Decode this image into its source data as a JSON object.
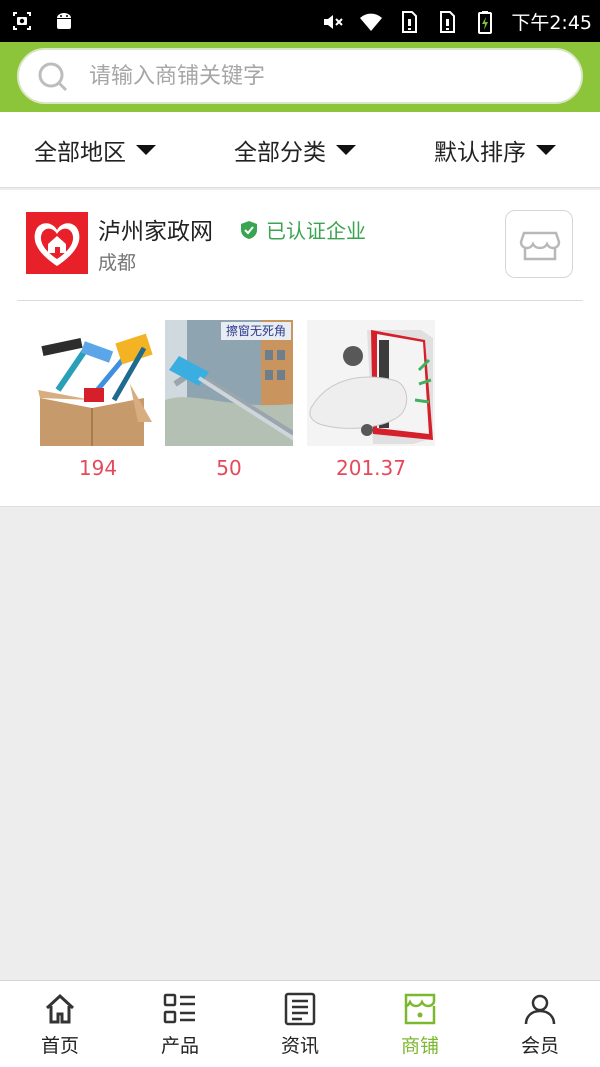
{
  "status_bar": {
    "time": "下午2:45"
  },
  "search": {
    "placeholder": "请输入商铺关键字"
  },
  "filters": [
    {
      "label": "全部地区"
    },
    {
      "label": "全部分类"
    },
    {
      "label": "默认排序"
    }
  ],
  "shop": {
    "name": "泸州家政网",
    "verified_label": "已认证企业",
    "city": "成都",
    "products": [
      {
        "price": "194"
      },
      {
        "price": "50"
      },
      {
        "price": "201.37"
      }
    ],
    "product2_overlay": "擦窗无死角"
  },
  "tabs": [
    {
      "label": "首页",
      "icon": "home-icon"
    },
    {
      "label": "产品",
      "icon": "list-icon"
    },
    {
      "label": "资讯",
      "icon": "news-icon"
    },
    {
      "label": "商铺",
      "icon": "store-icon",
      "active": true
    },
    {
      "label": "会员",
      "icon": "user-icon"
    }
  ],
  "colors": {
    "brand_green": "#8cc43a",
    "active_tab": "#7cb82f",
    "price": "#e64a5a",
    "verified": "#3ba451",
    "logo_red": "#e8202a"
  }
}
